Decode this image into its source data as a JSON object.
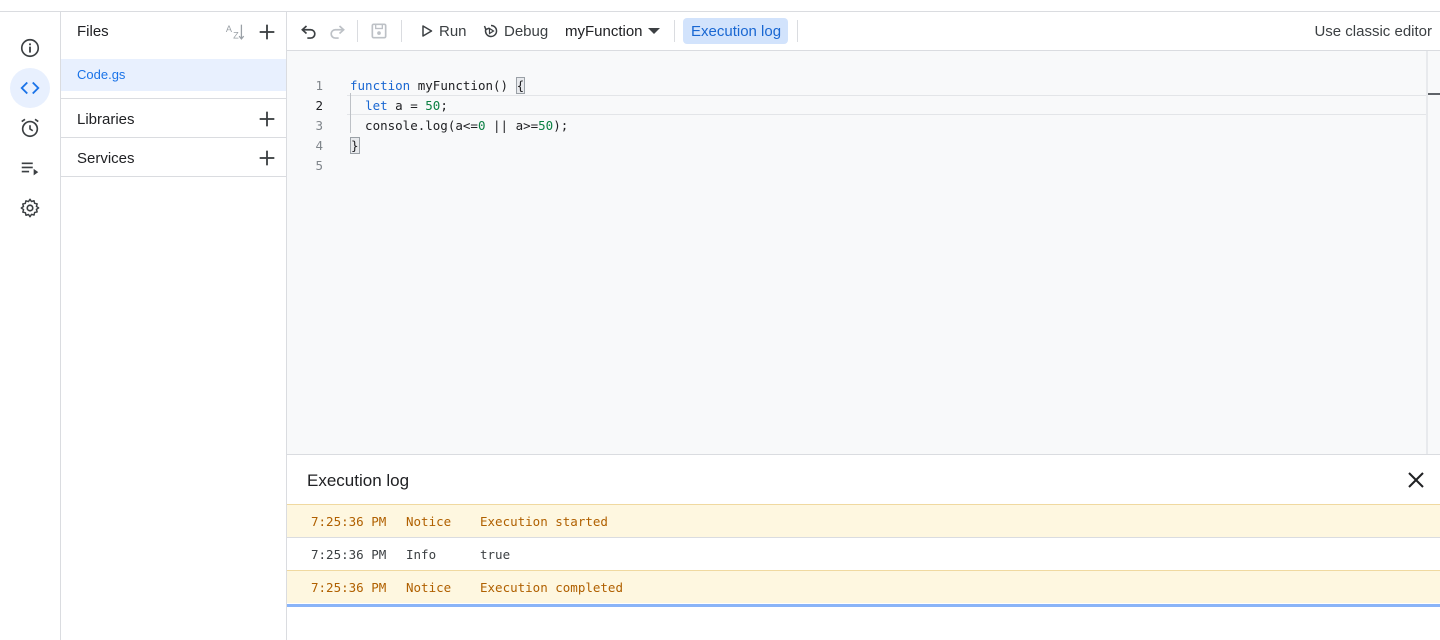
{
  "rail": {
    "items": [
      {
        "name": "overview",
        "icon": "info-icon"
      },
      {
        "name": "editor",
        "icon": "code-icon",
        "active": true
      },
      {
        "name": "triggers",
        "icon": "alarm-icon"
      },
      {
        "name": "executions",
        "icon": "playlist-play-icon"
      },
      {
        "name": "settings",
        "icon": "gear-icon"
      }
    ]
  },
  "files_panel": {
    "title": "Files",
    "files": [
      {
        "name": "Code.gs",
        "selected": true
      }
    ],
    "libraries_label": "Libraries",
    "services_label": "Services"
  },
  "toolbar": {
    "run_label": "Run",
    "debug_label": "Debug",
    "function_select": "myFunction",
    "execution_log_label": "Execution log",
    "classic_editor_label": "Use classic editor"
  },
  "editor": {
    "current_line": 2,
    "lines": [
      {
        "number": "1",
        "text": "function myFunction() {"
      },
      {
        "number": "2",
        "text": "  let a = 50;"
      },
      {
        "number": "3",
        "text": "  console.log(a<=0 || a>=50);"
      },
      {
        "number": "4",
        "text": "}"
      },
      {
        "number": "5",
        "text": ""
      }
    ]
  },
  "execution_log": {
    "title": "Execution log",
    "rows": [
      {
        "time": "7:25:36 PM",
        "level": "Notice",
        "message": "Execution started"
      },
      {
        "time": "7:25:36 PM",
        "level": "Info",
        "message": "true"
      },
      {
        "time": "7:25:36 PM",
        "level": "Notice",
        "message": "Execution completed"
      }
    ]
  },
  "colors": {
    "accent": "#1a73e8",
    "active_bg": "#e8f0fe",
    "notice_bg": "#fef7e0",
    "notice_text": "#b06000"
  }
}
